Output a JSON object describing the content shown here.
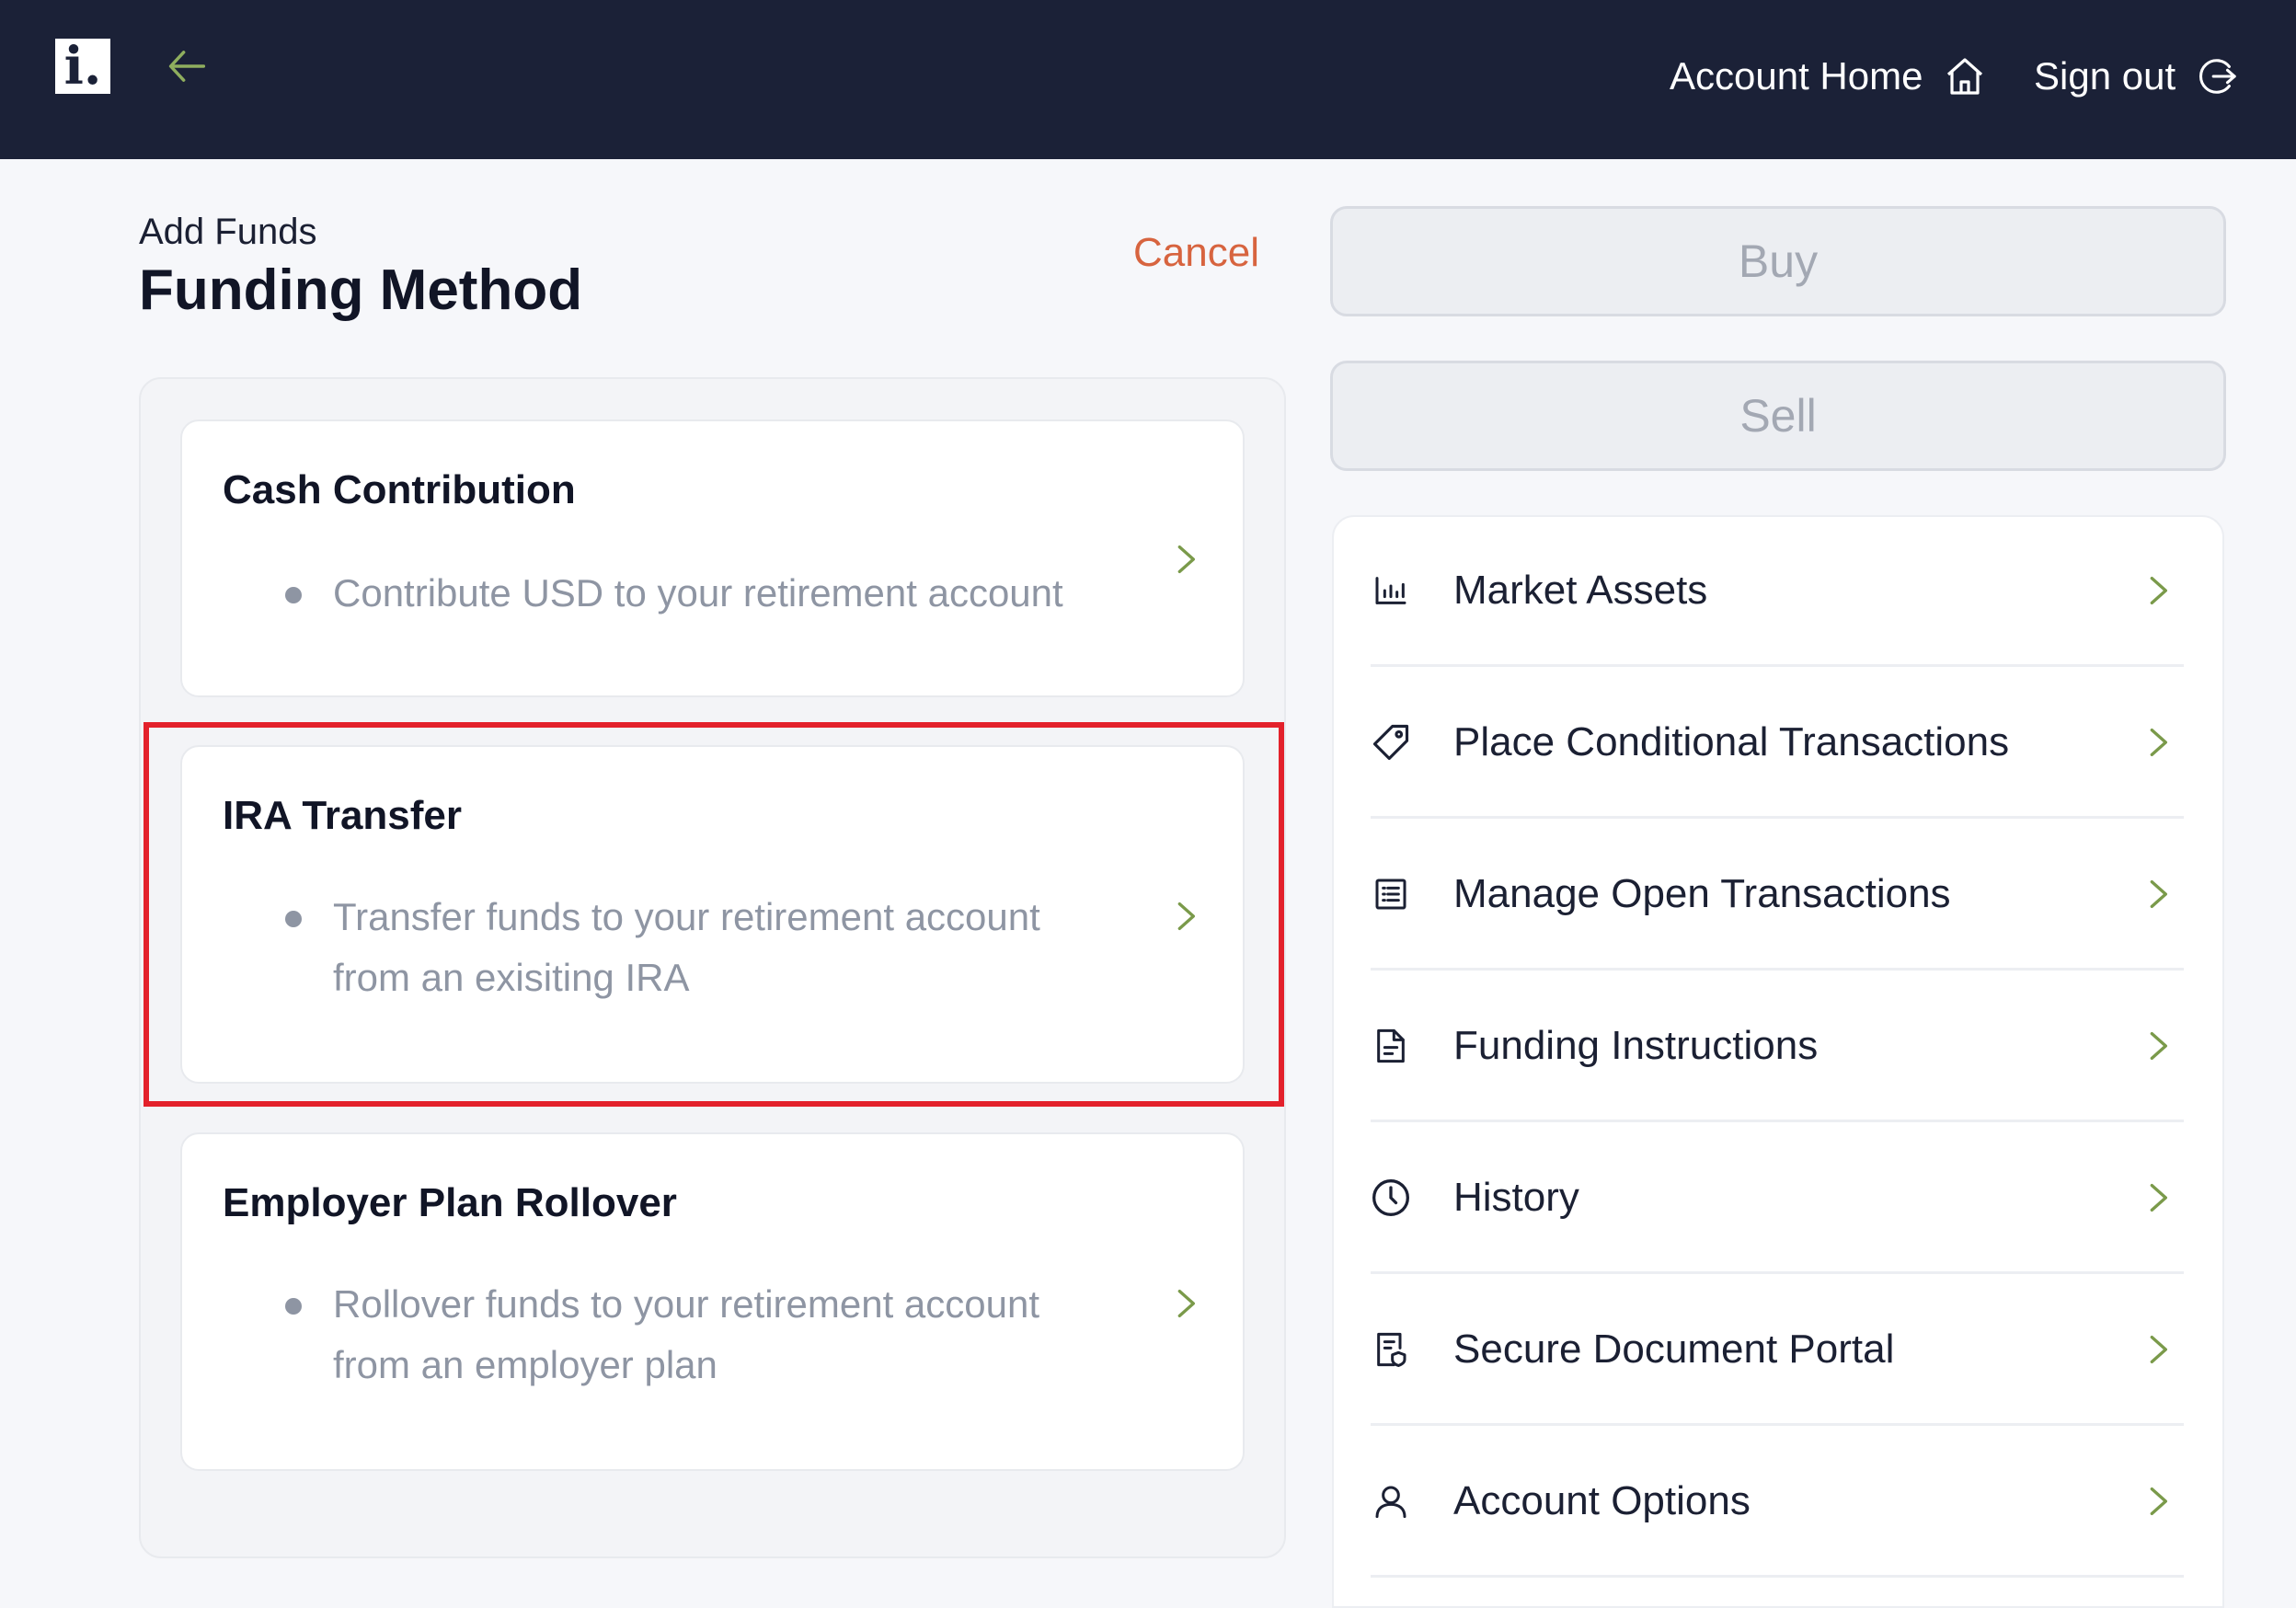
{
  "header": {
    "logo_text": "i.",
    "account_home_label": "Account Home",
    "sign_out_label": "Sign out"
  },
  "page": {
    "subtitle": "Add Funds",
    "title": "Funding Method",
    "cancel_label": "Cancel"
  },
  "funding_options": [
    {
      "title": "Cash Contribution",
      "description": "Contribute USD to your retirement account"
    },
    {
      "title": "IRA Transfer",
      "description": "Transfer funds to your retirement account from an exisiting IRA"
    },
    {
      "title": "Employer Plan Rollover",
      "description": "Rollover funds to your retirement account from an employer plan"
    }
  ],
  "actions": {
    "buy_label": "Buy",
    "sell_label": "Sell"
  },
  "menu": [
    {
      "label": "Market Assets",
      "icon": "bar-chart-icon"
    },
    {
      "label": "Place Conditional Transactions",
      "icon": "tag-icon"
    },
    {
      "label": "Manage Open Transactions",
      "icon": "list-icon"
    },
    {
      "label": "Funding Instructions",
      "icon": "document-icon"
    },
    {
      "label": "History",
      "icon": "clock-icon"
    },
    {
      "label": "Secure Document Portal",
      "icon": "secure-document-icon"
    },
    {
      "label": "Account Options",
      "icon": "user-icon"
    }
  ],
  "colors": {
    "header_bg": "#1b2137",
    "accent_green": "#7a9a4a",
    "cancel_orange": "#d7643f",
    "highlight_red": "#e3212b"
  }
}
